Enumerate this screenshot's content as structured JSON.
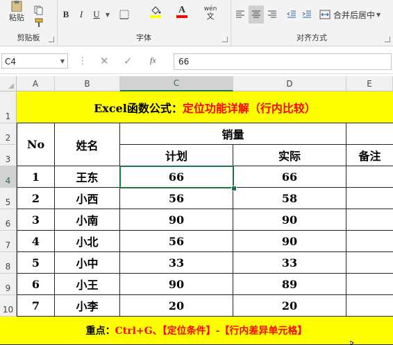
{
  "ribbon": {
    "clipboard": {
      "paste_label": "粘贴",
      "group_label": "剪贴板"
    },
    "font": {
      "bold": "B",
      "italic": "I",
      "underline": "U",
      "phonetic": "wén",
      "group_label": "字体"
    },
    "align": {
      "merge_label": "合并后居中",
      "group_label": "对齐方式"
    }
  },
  "formula_bar": {
    "name_box": "C4",
    "fx": "fx",
    "value": "66"
  },
  "columns": [
    "A",
    "B",
    "C",
    "D",
    "E"
  ],
  "rows": [
    "1",
    "2",
    "3",
    "4",
    "5",
    "6",
    "7",
    "8",
    "9",
    "10"
  ],
  "sheet": {
    "title_black": "Excel函数公式：",
    "title_red": "定位功能详解（行内比较）",
    "hdr_no": "No",
    "hdr_name": "姓名",
    "hdr_sales": "销量",
    "hdr_plan": "计划",
    "hdr_actual": "实际",
    "hdr_note": "备注",
    "data": [
      {
        "no": "1",
        "name": "王东",
        "plan": "66",
        "actual": "66"
      },
      {
        "no": "2",
        "name": "小西",
        "plan": "56",
        "actual": "58"
      },
      {
        "no": "3",
        "name": "小南",
        "plan": "90",
        "actual": "90"
      },
      {
        "no": "4",
        "name": "小北",
        "plan": "56",
        "actual": "90"
      },
      {
        "no": "5",
        "name": "小中",
        "plan": "33",
        "actual": "33"
      },
      {
        "no": "6",
        "name": "小王",
        "plan": "90",
        "actual": "89"
      },
      {
        "no": "7",
        "name": "小李",
        "plan": "20",
        "actual": "20"
      }
    ],
    "footer_black": "重点：",
    "footer_red": "Ctrl+G、【定位条件】-【行内差异单元格】"
  },
  "colors": {
    "highlight": "#ffff00",
    "accent_red": "#ff0000",
    "excel_green": "#217346"
  }
}
